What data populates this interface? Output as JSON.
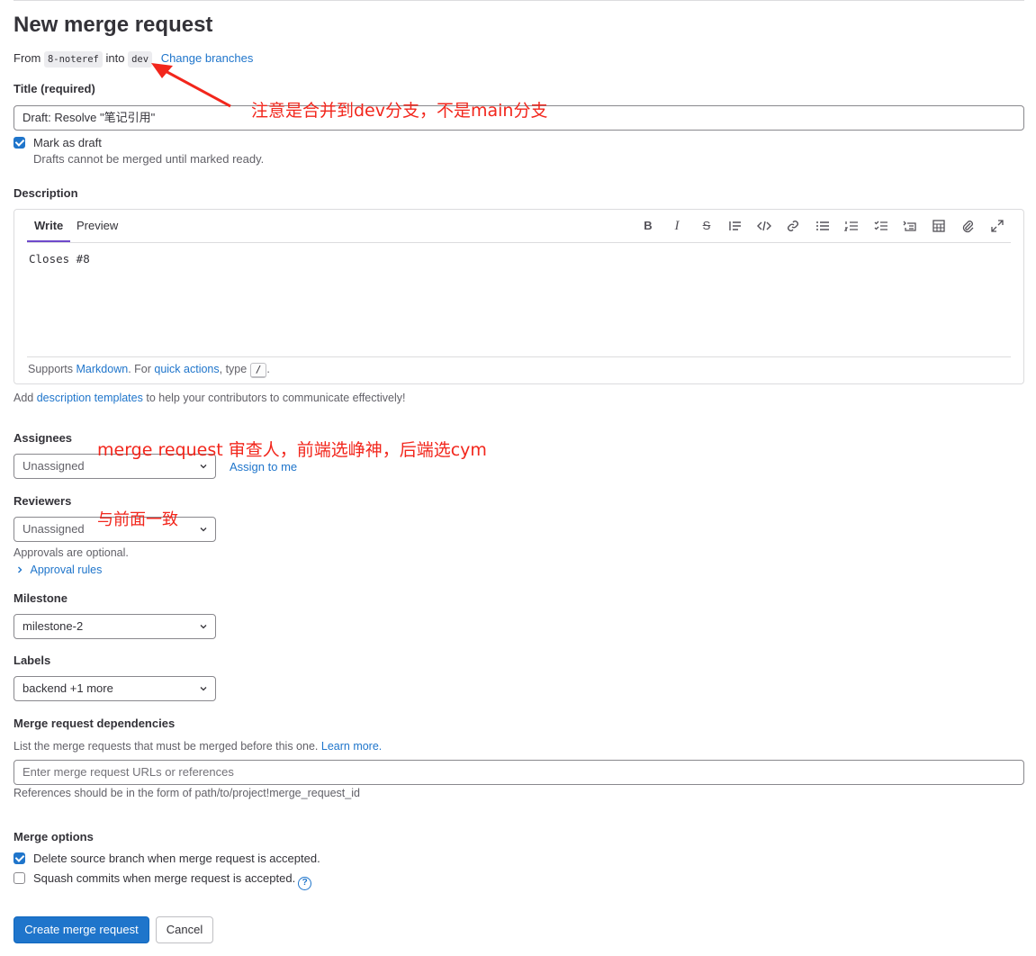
{
  "page": {
    "title": "New merge request"
  },
  "branches": {
    "from_word": "From",
    "source": "8-noteref",
    "into_word": "into",
    "target": "dev",
    "change_link": "Change branches"
  },
  "title_field": {
    "label": "Title (required)",
    "value": "Draft: Resolve \"笔记引用\""
  },
  "draft": {
    "label": "Mark as draft",
    "checked": true,
    "help": "Drafts cannot be merged until marked ready."
  },
  "description": {
    "label": "Description",
    "tabs": [
      "Write",
      "Preview"
    ],
    "active_tab": "Write",
    "toolbar_icons": [
      "bold-icon",
      "italic-icon",
      "strikethrough-icon",
      "quote-icon",
      "code-icon",
      "link-icon",
      "bullet-list-icon",
      "numbered-list-icon",
      "task-list-icon",
      "collapsible-icon",
      "table-icon",
      "attach-icon",
      "fullscreen-icon"
    ],
    "text": "Closes #8",
    "footer": {
      "prefix": "Supports",
      "markdown_link": "Markdown",
      "middle": ". For",
      "quick_actions_link": "quick actions",
      "type_text": ", type",
      "slash_key": "/",
      "end": "."
    },
    "templates_hint": {
      "prefix": "Add",
      "link": "description templates",
      "suffix": "to help your contributors to communicate effectively!"
    }
  },
  "assignees": {
    "label": "Assignees",
    "value": "Unassigned",
    "assign_me_link": "Assign to me"
  },
  "reviewers": {
    "label": "Reviewers",
    "value": "Unassigned",
    "approvals_text": "Approvals are optional.",
    "approval_rules_link": "Approval rules"
  },
  "milestone": {
    "label": "Milestone",
    "value": "milestone-2"
  },
  "labels": {
    "label": "Labels",
    "value": "backend +1 more"
  },
  "dependencies": {
    "label": "Merge request dependencies",
    "help_text": "List the merge requests that must be merged before this one.",
    "learn_more_link": "Learn more.",
    "placeholder": "Enter merge request URLs or references",
    "reference_hint": "References should be in the form of path/to/project!merge_request_id"
  },
  "merge_options": {
    "label": "Merge options",
    "delete_source": {
      "label": "Delete source branch when merge request is accepted.",
      "checked": true
    },
    "squash": {
      "label": "Squash commits when merge request is accepted.",
      "checked": false
    }
  },
  "actions": {
    "create": "Create merge request",
    "cancel": "Cancel"
  },
  "annotations": {
    "branch_note": "注意是合并到dev分支，不是main分支",
    "reviewer_note": "merge request 审查人，前端选峥神，后端选cym",
    "same_note": "与前面一致",
    "color": "#f2261c"
  },
  "colors": {
    "link": "#1f75cb",
    "primary": "#1f75cb",
    "tab_underline": "#6e49cb"
  }
}
